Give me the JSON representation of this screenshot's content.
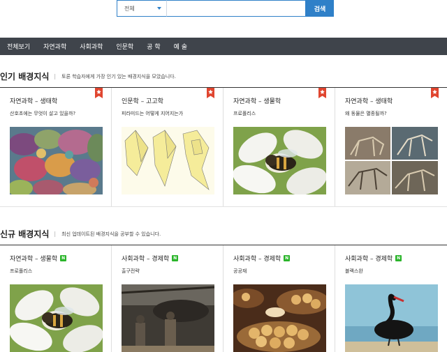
{
  "search": {
    "scope": "전체",
    "value": "",
    "button": "검색"
  },
  "nav": [
    "전체보기",
    "자연과학",
    "사회과학",
    "인문학",
    "공 학",
    "예 술"
  ],
  "popular": {
    "title": "인기 배경지식",
    "desc": "토론 학습자에게 가장 인기 있는 배경지식을 모았습니다.",
    "cards": [
      {
        "category": "자연과학 – 생태학",
        "question": "산호초에는 무엇이 살고 있을까?",
        "image": "coral-reef"
      },
      {
        "category": "인문학 – 고고학",
        "question": "피라미드는 어떻게 지어지는가",
        "image": "pyramid-diagram"
      },
      {
        "category": "자연과학 – 생물학",
        "question": "프로폴리스",
        "image": "bee-flower"
      },
      {
        "category": "자연과학 – 생태학",
        "question": "왜 동물은 멸종될까?",
        "image": "dinosaur-fossils"
      }
    ]
  },
  "recent": {
    "title": "신규 배경지식",
    "desc": "최신 업데이트된 배경지식을 공부할 수 있습니다.",
    "badge": "N",
    "cards": [
      {
        "category": "자연과학 – 생물학",
        "question": "프로폴리스",
        "image": "bee-flower"
      },
      {
        "category": "사회과학 – 경제학",
        "question": "출구전략",
        "image": "soldiers-helicopter"
      },
      {
        "category": "사회과학 – 경제학",
        "question": "공공재",
        "image": "bread-baskets"
      },
      {
        "category": "사회과학 – 경제학",
        "question": "블랙스완",
        "image": "black-swan"
      }
    ]
  },
  "colors": {
    "accent": "#2f80c8",
    "nav": "#3f444b",
    "bookmark": "#e0452f",
    "badge": "#2bb52b"
  }
}
